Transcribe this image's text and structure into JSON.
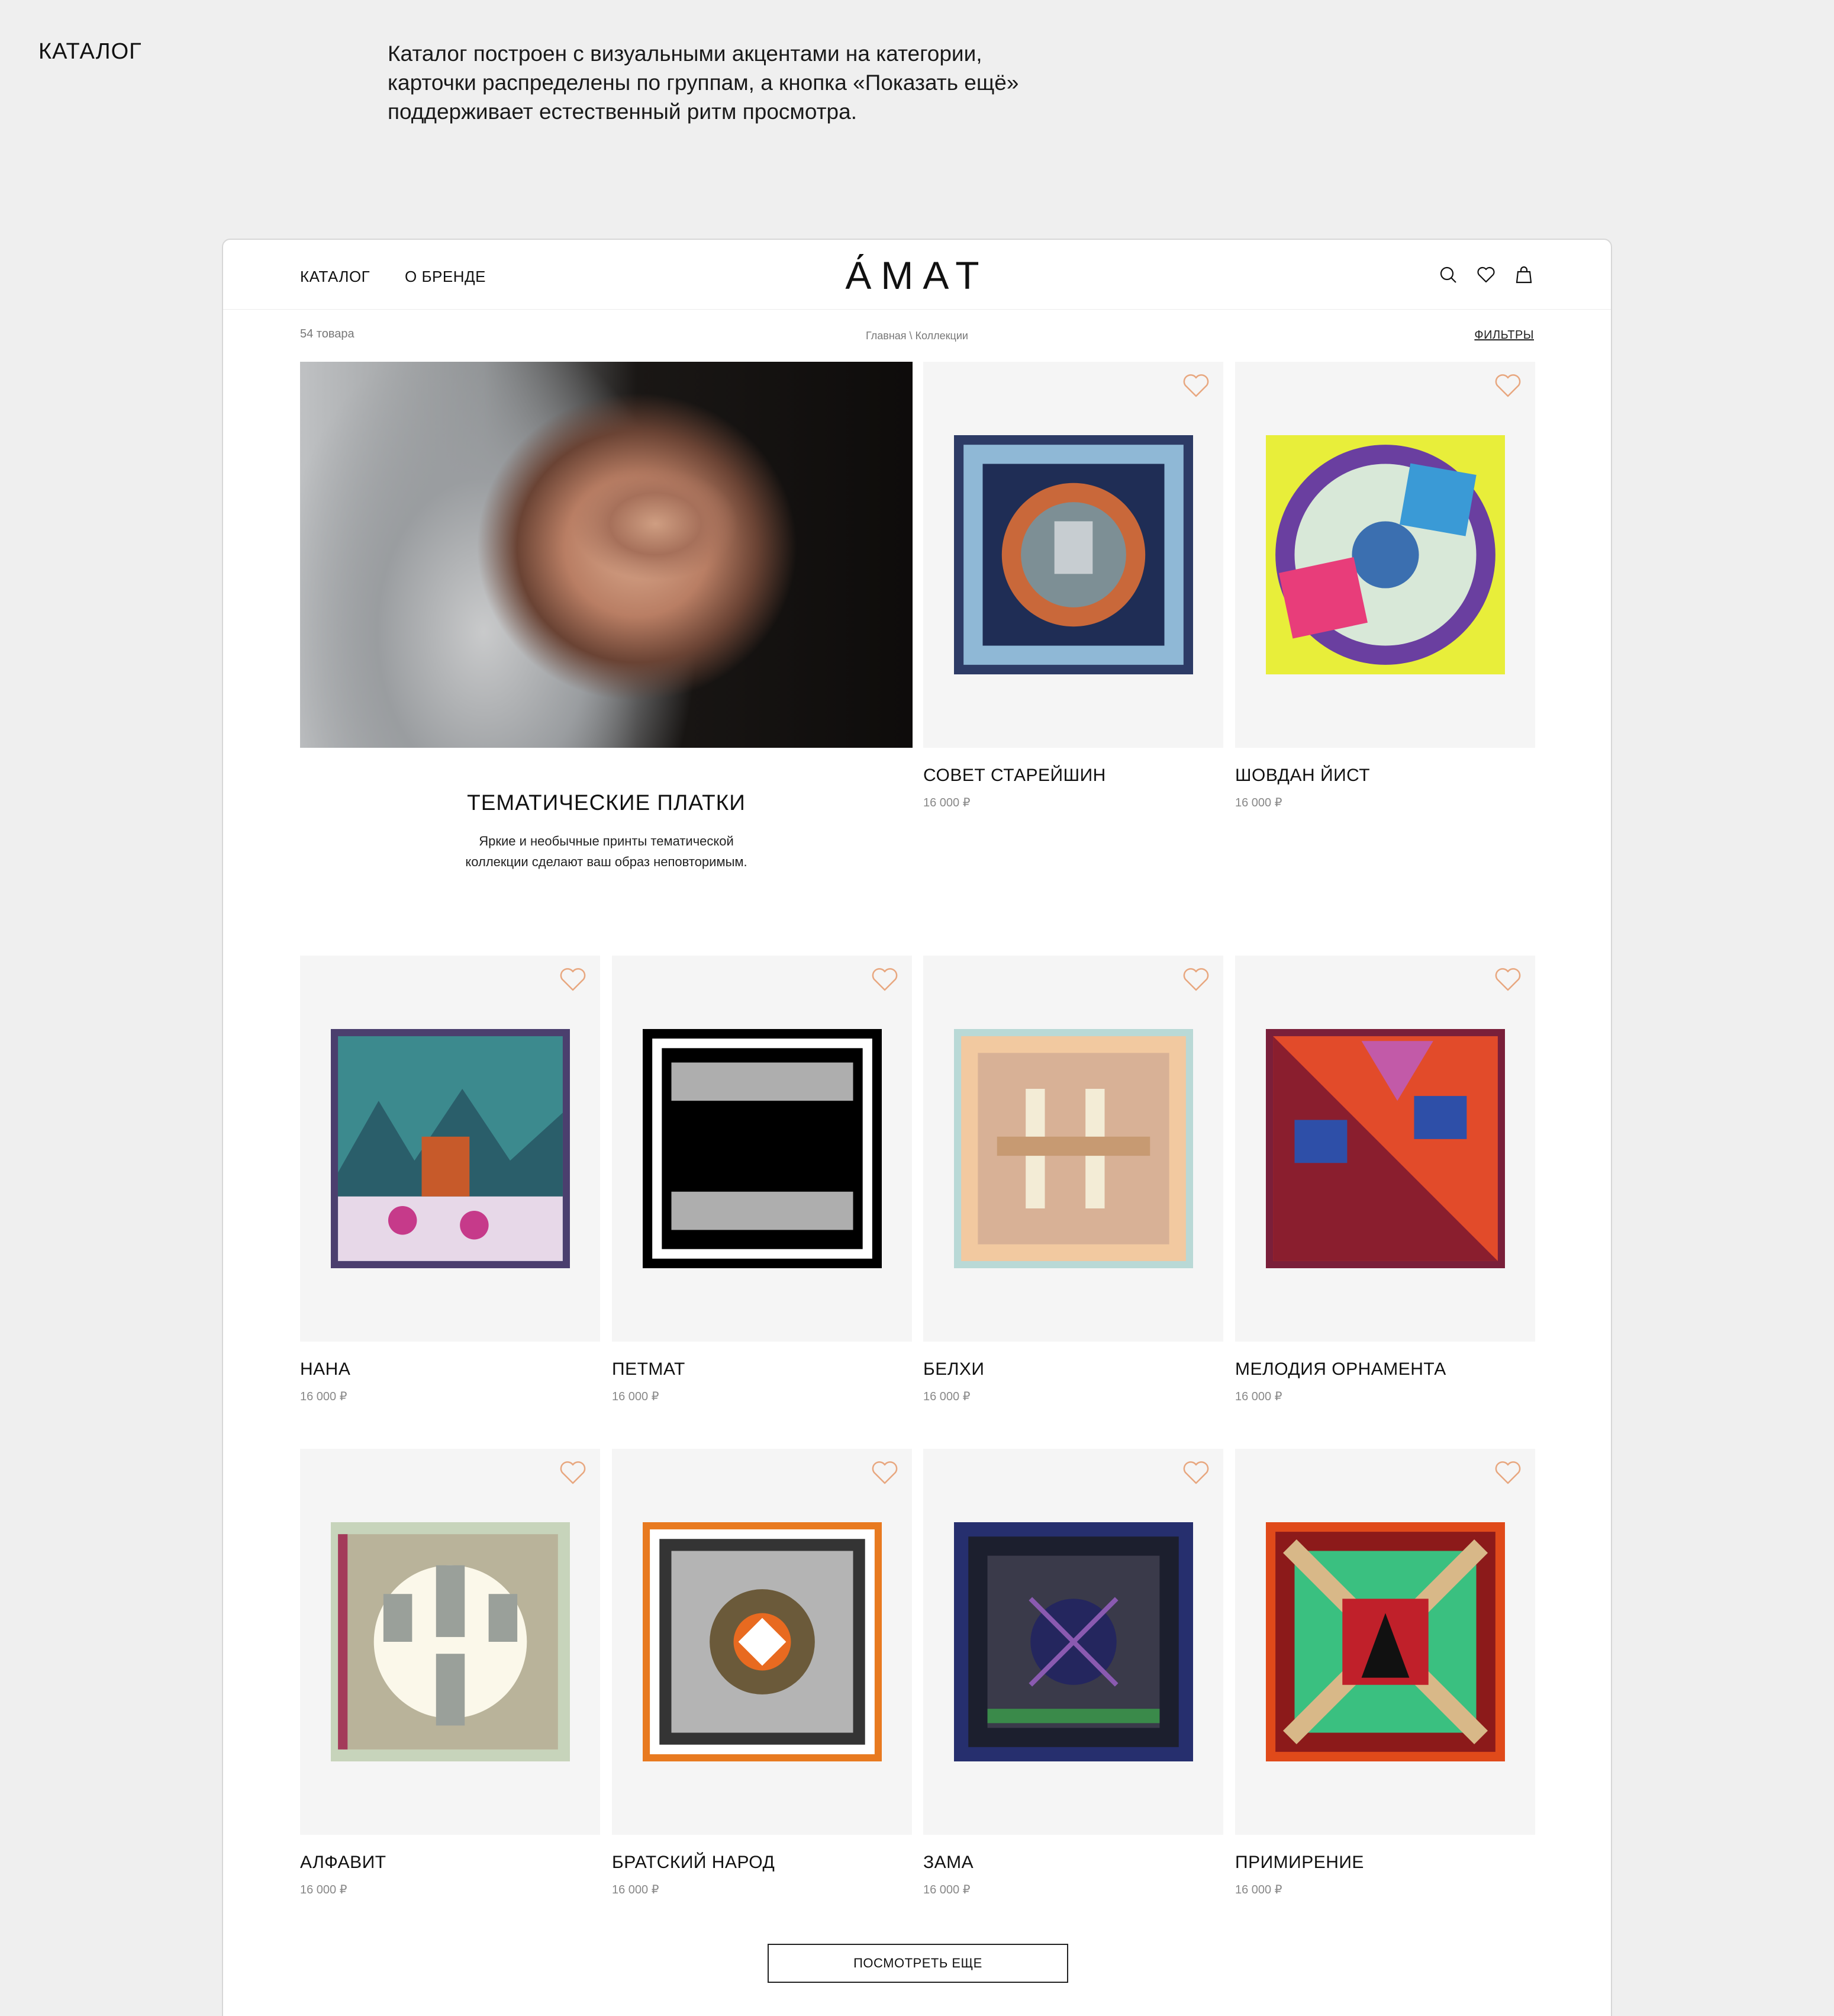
{
  "section": {
    "label": "КАТАЛОГ",
    "description_lines": [
      "Каталог построен с визуальными акцентами на категории,",
      "карточки распределены по группам, а кнопка «Показать ещё»",
      "поддерживает естественный ритм просмотра."
    ]
  },
  "header": {
    "nav": [
      "КАТАЛОГ",
      "О БРЕНДЕ"
    ],
    "logo": "А́МАТ",
    "icons": [
      "search-icon",
      "heart-icon",
      "bag-icon"
    ]
  },
  "toolbar": {
    "count": "54 товара",
    "breadcrumb": "Главная \\ Коллекции",
    "filters": "ФИЛЬТРЫ"
  },
  "promo": {
    "title": "ТЕМАТИЧЕСКИЕ ПЛАТКИ",
    "text_lines": [
      "Яркие и необычные принты тематической",
      "коллекции сделают ваш образ неповторимым."
    ]
  },
  "products": [
    {
      "name": "СОВЕТ СТАРЕЙШИН",
      "price": "16 000 ₽"
    },
    {
      "name": "ШОВДАН ЙИСТ",
      "price": "16 000 ₽"
    },
    {
      "name": "НАНА",
      "price": "16 000 ₽"
    },
    {
      "name": "ПЕТМАТ",
      "price": "16 000 ₽"
    },
    {
      "name": "БЕЛХИ",
      "price": "16 000 ₽"
    },
    {
      "name": "МЕЛОДИЯ ОРНАМЕНТА",
      "price": "16 000 ₽"
    },
    {
      "name": "АЛФАВИТ",
      "price": "16 000 ₽"
    },
    {
      "name": "БРАТСКИЙ НАРОД",
      "price": "16 000 ₽"
    },
    {
      "name": "ЗАМА",
      "price": "16 000 ₽"
    },
    {
      "name": "ПРИМИРЕНИЕ",
      "price": "16 000 ₽"
    }
  ],
  "show_more": "ПОСМОТРЕТЬ ЕЩЕ",
  "colors": {
    "heart": "#e8a77f",
    "card_bg": "#f5f5f5",
    "page_bg": "#efefef"
  }
}
